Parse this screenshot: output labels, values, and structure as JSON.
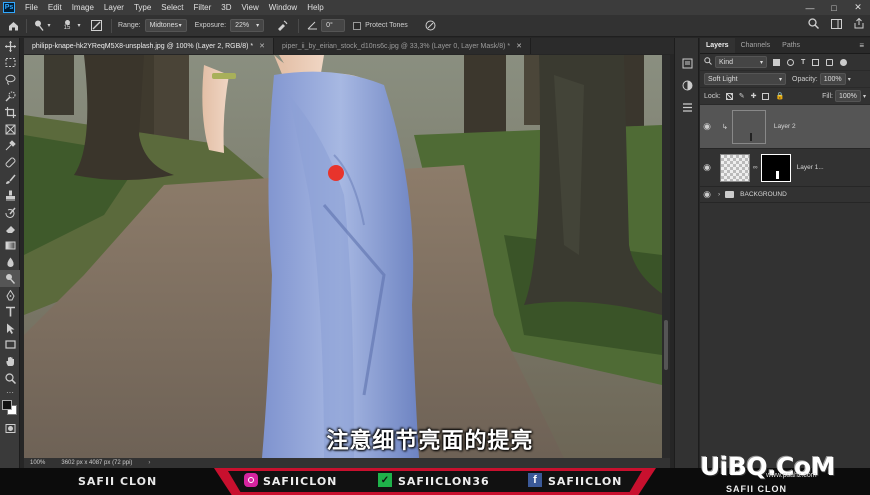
{
  "menubar": {
    "logo": "Ps",
    "items": [
      "File",
      "Edit",
      "Image",
      "Layer",
      "Type",
      "Select",
      "Filter",
      "3D",
      "View",
      "Window",
      "Help"
    ]
  },
  "options": {
    "brush_size": "15",
    "range_label": "Range:",
    "range_value": "Midtones",
    "exposure_label": "Exposure:",
    "exposure_value": "22%",
    "angle_value": "0°",
    "protect_tones_label": "Protect Tones"
  },
  "tabs": [
    {
      "label": "philipp-knape-hk2YReqM5X8-unsplash.jpg @ 100% (Layer 2, RGB/8) *",
      "active": true
    },
    {
      "label": "piper_ii_by_eirian_stock_d10ns6c.jpg @ 33,3% (Layer 0, Layer Mask/8) *",
      "active": false
    }
  ],
  "subtitle": "注意细节亮面的提亮",
  "status": {
    "zoom": "100%",
    "dimensions": "3602 px x 4087 px (72 ppi)"
  },
  "banner": {
    "left_name": "SAFII CLON",
    "instagram": "SAFIICLON",
    "other": "SAFIICLON36",
    "facebook": "SAFIICLON",
    "watermark": "UiBQ.CoM",
    "watermark_sub": "www.psahz.com",
    "bottom_text": "SAFII CLON"
  },
  "layers_panel": {
    "tabs": [
      "Layers",
      "Channels",
      "Paths"
    ],
    "kind_label": "Kind",
    "blend_mode": "Soft Light",
    "opacity_label": "Opacity:",
    "opacity_value": "100%",
    "lock_label": "Lock:",
    "fill_label": "Fill:",
    "fill_value": "100%",
    "layers": [
      {
        "name": "Layer 2",
        "selected": true
      },
      {
        "name": "Layer 1...",
        "selected": false
      },
      {
        "name": "BACKGROUND",
        "selected": false
      }
    ]
  },
  "colors": {
    "accent_red": "#c8102e",
    "panel_bg": "#323232",
    "menubar_bg": "#3c3c3c"
  }
}
